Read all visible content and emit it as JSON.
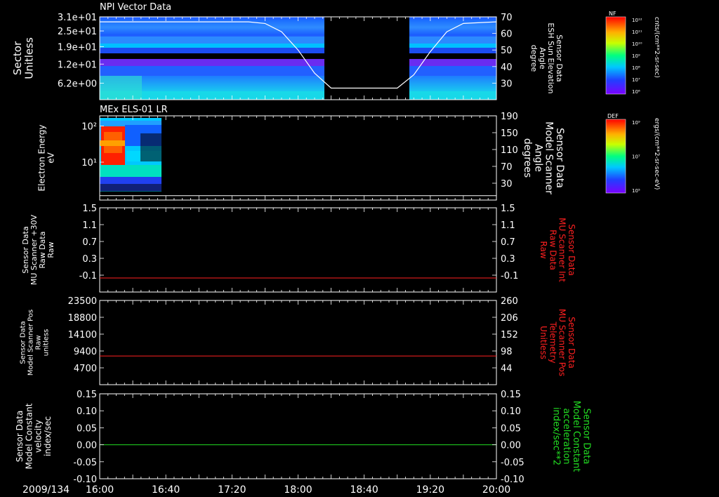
{
  "colors": {
    "background": "#000000",
    "foreground": "#ffffff",
    "red": "#ff2020",
    "green": "#22dd22",
    "white_line": "#ffffff"
  },
  "date_label": "2009/134",
  "time_ticks": [
    "16:00",
    "16:40",
    "17:20",
    "18:00",
    "18:40",
    "19:20",
    "20:00"
  ],
  "colorbars": [
    {
      "label": "NF",
      "units": "cnts/(cm**2-sr-sec)",
      "ticks": [
        "10¹²",
        "10¹¹",
        "10¹⁰",
        "10⁹",
        "10⁸",
        "10⁷",
        "10⁶"
      ]
    },
    {
      "label": "DEF",
      "units": "ergs/(cm**2-sr-sec-eV)",
      "ticks": [
        "10⁹",
        "10⁷",
        "10⁵"
      ]
    }
  ],
  "chart_data": [
    {
      "type": "heatmap",
      "title": "NPI Vector Data",
      "ylabel_left": [
        "Sector",
        "Unitless"
      ],
      "yticks_left": [
        "3.1e+01",
        "2.5e+01",
        "1.9e+01",
        "1.2e+01",
        "6.2e+00"
      ],
      "ylabel_right": [
        "Sensor Data",
        "ESH Sun Elevation",
        "Angle",
        "degree"
      ],
      "yticks_right": [
        "70",
        "60",
        "50",
        "40",
        "30"
      ],
      "ylim_right": [
        20,
        70
      ],
      "data_gap": [
        "18:15",
        "19:05"
      ],
      "overlay_line": {
        "name": "",
        "x": [
          "16:00",
          "17:30",
          "17:40",
          "17:50",
          "18:00",
          "18:10",
          "18:20",
          "18:40",
          "19:00",
          "19:10",
          "19:20",
          "19:30",
          "19:40",
          "20:00"
        ],
        "y": [
          67,
          67,
          66,
          61,
          50,
          36,
          27,
          27,
          27,
          35,
          49,
          61,
          66,
          67
        ]
      }
    },
    {
      "type": "heatmap",
      "title": "MEx ELS-01 LR",
      "ylabel_left": [
        "Electron Energy",
        "eV"
      ],
      "yticks_left": [
        "10²",
        "10¹"
      ],
      "ylabel_right": [
        "Sensor Data",
        "Model Scanner",
        "Angle",
        "degrees"
      ],
      "yticks_right": [
        "190",
        "150",
        "110",
        "70",
        "30"
      ],
      "ylim_right": [
        0,
        190
      ],
      "data_extent": [
        "16:00",
        "16:20"
      ],
      "overlay_line": {
        "name": "",
        "x": [
          "16:00",
          "20:00"
        ],
        "y": [
          10,
          10
        ]
      }
    },
    {
      "type": "line",
      "ylabel_left": [
        "Sensor Data",
        "MU Scanner +30V",
        "Raw Data",
        "Raw"
      ],
      "yticks_left": [
        "1.5",
        "1.1",
        "0.7",
        "0.3",
        "-0.1"
      ],
      "ylabel_right": [
        "Sensor Data",
        "MU Scanner Int",
        "Raw Data",
        "Raw"
      ],
      "yticks_right": [
        "1.5",
        "1.1",
        "0.7",
        "0.3",
        "-0.1"
      ],
      "ylim": [
        -0.3,
        1.5
      ],
      "series": [
        {
          "name": "",
          "color": "#ff2020",
          "x": [
            "16:00",
            "20:00"
          ],
          "y": [
            0.0,
            0.0
          ]
        }
      ]
    },
    {
      "type": "line",
      "ylabel_left": [
        "Sensor Data",
        "Model Scanner Pos",
        "Raw",
        "unitless"
      ],
      "yticks_left": [
        "23500",
        "18800",
        "14100",
        "9400",
        "4700"
      ],
      "ylabel_right": [
        "Sensor Data",
        "MU Scanner Pos",
        "Telemetry",
        "Unitless"
      ],
      "yticks_right": [
        "260",
        "206",
        "152",
        "98",
        "44"
      ],
      "ylim": [
        0,
        23500
      ],
      "series": [
        {
          "name": "",
          "color": "#ff2020",
          "x": [
            "16:00",
            "20:00"
          ],
          "y": [
            8000,
            8000
          ]
        }
      ]
    },
    {
      "type": "line",
      "ylabel_left": [
        "Sensor Data",
        "Model Constant",
        "velocity",
        "index/sec"
      ],
      "yticks_left": [
        "0.15",
        "0.10",
        "0.05",
        "0.00",
        "-0.05",
        "-0.10"
      ],
      "ylabel_right": [
        "Sensor Data",
        "Model Constant",
        "acceleration",
        "index/sec**2"
      ],
      "yticks_right": [
        "0.15",
        "0.10",
        "0.05",
        "0.00",
        "-0.05",
        "-0.10"
      ],
      "ylim": [
        -0.1,
        0.15
      ],
      "series": [
        {
          "name": "",
          "color": "#22dd22",
          "x": [
            "16:00",
            "20:00"
          ],
          "y": [
            0.0,
            0.0
          ]
        }
      ]
    }
  ]
}
